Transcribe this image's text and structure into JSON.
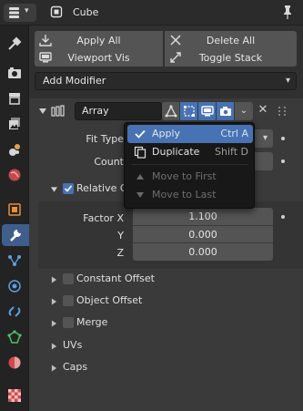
{
  "header": {
    "title": "Cube"
  },
  "toolbar": {
    "apply_all": "Apply All",
    "delete_all": "Delete All",
    "viewport_vis": "Viewport Vis",
    "toggle_stack": "Toggle Stack"
  },
  "add_modifier": {
    "label": "Add Modifier"
  },
  "modifier": {
    "name": "Array",
    "fit_type_label": "Fit Type",
    "count_label": "Count",
    "relative_offset_label": "Relative Offset",
    "relative_offset_visible": "Relative O",
    "factor_x_label": "Factor X",
    "factor_x": "1.100",
    "y_label": "Y",
    "factor_y": "0.000",
    "z_label": "Z",
    "factor_z": "0.000"
  },
  "subpanels": [
    {
      "label": "Constant Offset",
      "checkbox": true,
      "checked": false
    },
    {
      "label": "Object Offset",
      "checkbox": true,
      "checked": false
    },
    {
      "label": "Merge",
      "checkbox": true,
      "checked": false
    },
    {
      "label": "UVs",
      "checkbox": false
    },
    {
      "label": "Caps",
      "checkbox": false
    }
  ],
  "context_menu": {
    "items": [
      {
        "label": "Apply",
        "shortcut": "Ctrl A",
        "icon": "checkmark-icon",
        "active": true,
        "enabled": true
      },
      {
        "label": "Duplicate",
        "shortcut": "Shift D",
        "icon": "duplicate-icon",
        "active": false,
        "enabled": true
      },
      {
        "label": "Move to First",
        "shortcut": "",
        "icon": "triangle-up-icon",
        "active": false,
        "enabled": false
      },
      {
        "label": "Move to Last",
        "shortcut": "",
        "icon": "triangle-down-icon",
        "active": false,
        "enabled": false
      }
    ]
  },
  "colors": {
    "accent": "#4772b3",
    "panel_bg": "#3a3a3a",
    "menu_bg": "#181818"
  }
}
